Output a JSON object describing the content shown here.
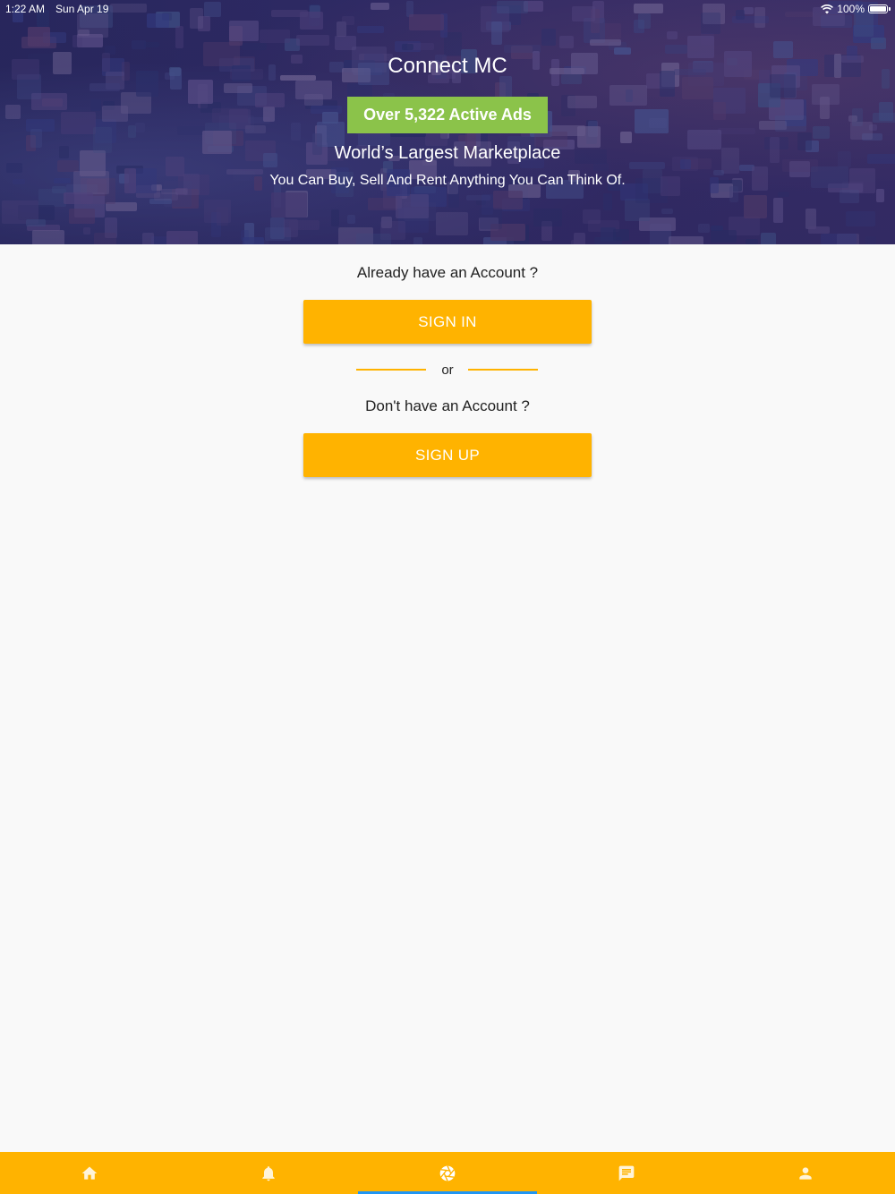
{
  "status_bar": {
    "time": "1:22 AM",
    "date": "Sun Apr 19",
    "battery": "100%"
  },
  "hero": {
    "title": "Connect MC",
    "ads_badge": "Over 5,322 Active Ads",
    "tagline": "World’s Largest Marketplace",
    "subtitle": "You Can Buy, Sell And Rent Anything You Can Think Of."
  },
  "auth": {
    "have_account_prompt": "Already have an Account ?",
    "sign_in_label": "SIGN IN",
    "or_text": "or",
    "no_account_prompt": "Don't have an Account ?",
    "sign_up_label": "SIGN UP"
  },
  "bottom_nav": {
    "items": [
      {
        "icon": "home-icon"
      },
      {
        "icon": "bell-icon"
      },
      {
        "icon": "aperture-icon",
        "active": true
      },
      {
        "icon": "chat-icon"
      },
      {
        "icon": "person-icon"
      }
    ]
  },
  "colors": {
    "accent": "#ffb300",
    "badge_green": "#8bc34a",
    "active_indicator": "#2196f3",
    "hero_bg": "#34306e"
  }
}
